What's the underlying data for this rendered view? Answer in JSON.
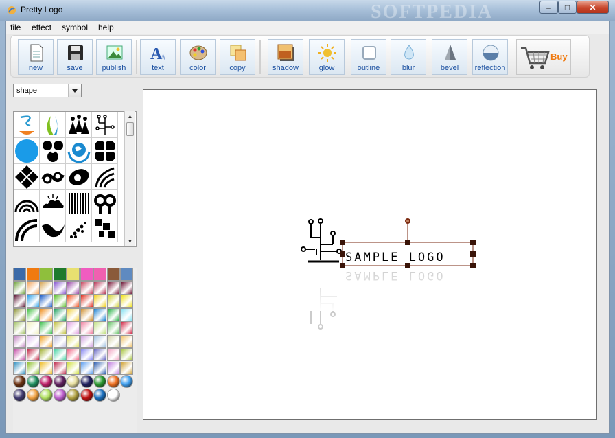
{
  "window": {
    "title": "Pretty Logo",
    "controls": {
      "minimize": "–",
      "maximize": "□",
      "close": "✕"
    },
    "watermark": "SOFTPEDIA"
  },
  "menu": {
    "items": [
      "file",
      "effect",
      "symbol",
      "help"
    ]
  },
  "toolbar": {
    "buttons": [
      {
        "label": "new",
        "icon": "new-document-icon"
      },
      {
        "label": "save",
        "icon": "floppy-disk-icon"
      },
      {
        "label": "publish",
        "icon": "picture-icon"
      },
      {
        "label": "text",
        "icon": "text-a-icon"
      },
      {
        "label": "color",
        "icon": "palette-icon"
      },
      {
        "label": "copy",
        "icon": "copy-icon"
      },
      {
        "label": "shadow",
        "icon": "shadow-icon"
      },
      {
        "label": "glow",
        "icon": "sun-glow-icon"
      },
      {
        "label": "outline",
        "icon": "outline-icon"
      },
      {
        "label": "blur",
        "icon": "drop-icon"
      },
      {
        "label": "bevel",
        "icon": "cone-icon"
      },
      {
        "label": "reflection",
        "icon": "reflection-icon"
      }
    ],
    "buy_label": "Buy"
  },
  "sidebar": {
    "shape_dropdown": {
      "selected": "shape"
    },
    "shape_icons": [
      "coffee-swirl-icon",
      "flame-leaves-icon",
      "people-group-icon",
      "circuit-tree-icon",
      "blue-circle-icon",
      "trefoil-icon",
      "globe-hands-icon",
      "four-leaf-icon",
      "diamond-tiles-icon",
      "infinity-swirl-icon",
      "oval-planet-icon",
      "wave-fan-icon",
      "rainbow-arcs-icon",
      "cloud-sun-icon",
      "barcode-stripes-icon",
      "double-spiral-icon",
      "arc-corner-icon",
      "wave-bird-icon",
      "dotted-slash-icon",
      "checker-blocks-icon"
    ]
  },
  "palette": {
    "colors": [
      "#3b6aa8",
      "#f07a10",
      "#8fbf3c",
      "#1f7a2c",
      "#e8e070",
      "#f05cc0",
      "#f060b0",
      "#8a5a3a",
      "#5f8ac0",
      "#6fa23a",
      "#f4a860",
      "#d8a858",
      "#8a5ad0",
      "#9a4aa8",
      "#c84860",
      "#b83858",
      "#7a1a3a",
      "#6a1030",
      "#5a1030",
      "#2ea0e8",
      "#2060c8",
      "#60c030",
      "#f05020",
      "#e03020",
      "#f0d020",
      "#d0d030",
      "#f0e010",
      "#8a9030",
      "#40c040",
      "#f09020",
      "#20a060",
      "#f0d040",
      "#d09030",
      "#1a80d0",
      "#20b040",
      "#80e0f0",
      "#a0c060",
      "#f0f0c0",
      "#40c050",
      "#c0c040",
      "#e0a0e0",
      "#f080a0",
      "#c0e080",
      "#60c060",
      "#d02040",
      "#c080c0",
      "#e0c0f0",
      "#f0a020",
      "#c0c0e0",
      "#e0e060",
      "#d0a0e0",
      "#a0c0e0",
      "#d0d0a0",
      "#f0c060",
      "#c040a0",
      "#c02040",
      "#a0b030",
      "#40d0a0",
      "#f06080",
      "#8080f0",
      "#6060c0",
      "#f0a0c0",
      "#a0c030",
      "#3090c0",
      "#90c030",
      "#f0c030",
      "#c03050",
      "#d0e040",
      "#60a0f0",
      "#3060b0",
      "#c080e0",
      "#d0a030",
      "#6a3010",
      "#209060",
      "#c0206a",
      "#602060",
      "#e8e0a0",
      "#202060",
      "#2a9a30",
      "#f07020",
      "#40a0f0",
      "#403a70",
      "#f0a040",
      "#b0e060",
      "#c060d0",
      "#b0a040",
      "#c01010",
      "#1a70c0",
      "#ffffff"
    ]
  }
}
